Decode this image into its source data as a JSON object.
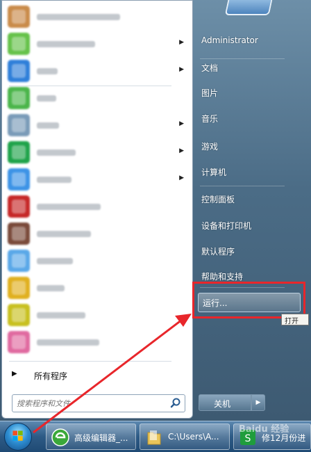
{
  "start_menu": {
    "pinned_programs": [
      {
        "icon": "blurred-app-icon",
        "color": "#c98b4a",
        "has_submenu": false,
        "text_width": 120
      },
      {
        "icon": "blurred-app-icon",
        "color": "#66c24a",
        "has_submenu": true,
        "text_width": 84
      },
      {
        "icon": "blurred-app-icon",
        "color": "#2f7fd9",
        "has_submenu": true,
        "text_width": 30
      },
      {
        "icon": "blurred-app-icon",
        "color": "#4bb54a",
        "has_submenu": false,
        "text_width": 28
      },
      {
        "icon": "blurred-app-icon",
        "color": "#7a9bb8",
        "has_submenu": true,
        "text_width": 32
      },
      {
        "icon": "blurred-app-icon",
        "color": "#1fa34a",
        "has_submenu": true,
        "text_width": 56
      },
      {
        "icon": "blurred-app-icon",
        "color": "#3d93e6",
        "has_submenu": true,
        "text_width": 50
      },
      {
        "icon": "blurred-app-icon",
        "color": "#c62828",
        "has_submenu": false,
        "text_width": 92
      },
      {
        "icon": "blurred-app-icon",
        "color": "#7a4a3a",
        "has_submenu": false,
        "text_width": 78
      },
      {
        "icon": "blurred-app-icon",
        "color": "#5aa8e8",
        "has_submenu": false,
        "text_width": 52
      },
      {
        "icon": "blurred-app-icon",
        "color": "#e0b020",
        "has_submenu": false,
        "text_width": 40
      },
      {
        "icon": "blurred-app-icon",
        "color": "#c8c020",
        "has_submenu": false,
        "text_width": 70
      },
      {
        "icon": "blurred-app-icon",
        "color": "#e06aa0",
        "has_submenu": false,
        "text_width": 90
      }
    ],
    "all_programs_label": "所有程序",
    "search": {
      "placeholder": "搜索程序和文件"
    },
    "right_items": [
      {
        "label": "Administrator"
      },
      {
        "label": "文档"
      },
      {
        "label": "图片"
      },
      {
        "label": "音乐"
      },
      {
        "label": "游戏"
      },
      {
        "label": "计算机"
      },
      {
        "label": "控制面板"
      },
      {
        "label": "设备和打印机"
      },
      {
        "label": "默认程序"
      },
      {
        "label": "帮助和支持"
      }
    ],
    "run_label": "运行...",
    "tooltip_text": "打开",
    "shutdown_label": "关机"
  },
  "taskbar": {
    "buttons": [
      {
        "label": "高级编辑器_...",
        "icon": "browser-icon"
      },
      {
        "label": "C:\\Users\\A...",
        "icon": "folder-icon"
      },
      {
        "label": "修12月份进",
        "icon": "app-icon"
      }
    ]
  },
  "annotation": {
    "color": "#e8262b"
  },
  "watermark": "Baidu 经验"
}
